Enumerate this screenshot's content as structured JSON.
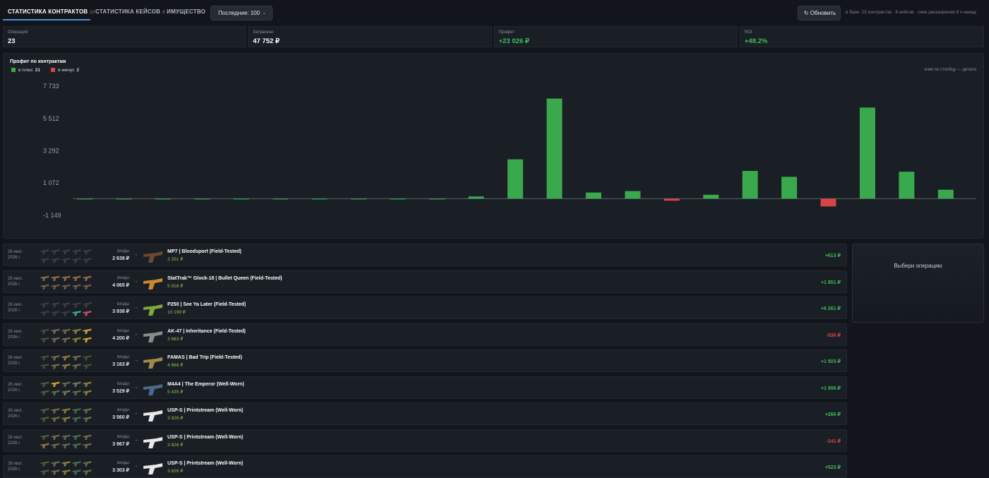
{
  "tabs": [
    {
      "label": "СТАТИСТИКА КОНТРАКТОВ",
      "count": "23",
      "active": true
    },
    {
      "label": "СТАТИСТИКА КЕЙСОВ",
      "count": "8",
      "active": false
    },
    {
      "label": "ИМУЩЕСТВО",
      "count": "",
      "active": false
    }
  ],
  "filter": {
    "value": "Последние: 100"
  },
  "refresh_label": "↻ Обновить",
  "db_info": "в базе: 23 контрактов · 8 кейсов · синк расширения 9 ч назад",
  "stats": [
    {
      "label": "Операций",
      "value": "23",
      "positive": false
    },
    {
      "label": "Затрачено",
      "value": "47 752 ₽",
      "positive": false
    },
    {
      "label": "Профит",
      "value": "+23 026 ₽",
      "positive": true
    },
    {
      "label": "ROI",
      "value": "+48.2%",
      "positive": true
    }
  ],
  "chart": {
    "title": "Профит по контрактам",
    "legend_pos_label": "в плюс",
    "legend_pos_count": "21",
    "legend_neg_label": "в минус",
    "legend_neg_count": "2",
    "hint": "клик по столбцу — детали"
  },
  "chart_data": {
    "type": "bar",
    "title": "Профит по контрактам",
    "ytick_labels": [
      "7 733",
      "5 512",
      "3 292",
      "1 072",
      "-1 149"
    ],
    "ylim": [
      -1149,
      7733
    ],
    "series": [
      {
        "name": "в плюс",
        "color": "#3aa84c"
      },
      {
        "name": "в минус",
        "color": "#d64545"
      }
    ],
    "values": [
      5,
      5,
      5,
      5,
      5,
      5,
      5,
      5,
      5,
      5,
      150,
      2700,
      6880,
      420,
      520,
      -141,
      266,
      1906,
      1503,
      -536,
      6261,
      1851,
      613
    ]
  },
  "side_panel": "Выбери операцию",
  "rows": [
    {
      "date1": "26 июл.",
      "date2": "2026 г.",
      "inputs_label": "входы",
      "inputs_total": "2 638 ₽",
      "arrow": "→",
      "out_name": "MP7 | Bloodsport (Field-Tested)",
      "out_price": "3 251 ₽",
      "profit": "+613 ₽",
      "positive": true,
      "out_color": "#6a4a2e",
      "in_colors": [
        "#3a3d42",
        "#3a3d42",
        "#3a3d42",
        "#3a3d42",
        "#3a3d42",
        "#3a3d42",
        "#3a3d42",
        "#3a3d42",
        "#3a3d42",
        "#3a3d42"
      ]
    },
    {
      "date1": "26 июл.",
      "date2": "2026 г.",
      "inputs_label": "входы",
      "inputs_total": "4 065 ₽",
      "arrow": "→",
      "out_name": "StatTrak™ Glock-18 | Bullet Queen (Field-Tested)",
      "out_price": "5 916 ₽",
      "profit": "+1 851 ₽",
      "positive": true,
      "out_color": "#c98a2a",
      "in_colors": [
        "#8a6a4a",
        "#8a6a4a",
        "#8a6a4a",
        "#8a6a4a",
        "#8a6a4a",
        "#6a5a4a",
        "#6a5a4a",
        "#6a5a4a",
        "#6a5a4a",
        "#6a5a4a"
      ]
    },
    {
      "date1": "26 июл.",
      "date2": "2026 г.",
      "inputs_label": "входы",
      "inputs_total": "3 938 ₽",
      "arrow": "→",
      "out_name": "P250 | See Ya Later (Field-Tested)",
      "out_price": "10 199 ₽",
      "profit": "+6 261 ₽",
      "positive": true,
      "out_color": "#7fa83a",
      "in_colors": [
        "#3a3d42",
        "#3a3d42",
        "#3a3d42",
        "#3a3d42",
        "#3a3d42",
        "#3a3d42",
        "#3a3d42",
        "#3a3d42",
        "#3aa89a",
        "#c94a6a"
      ]
    },
    {
      "date1": "26 июл.",
      "date2": "2026 г.",
      "inputs_label": "входы",
      "inputs_total": "4 200 ₽",
      "arrow": "→",
      "out_name": "AK-47 | Inheritance (Field-Tested)",
      "out_price": "3 663 ₽",
      "profit": "-536 ₽",
      "positive": false,
      "out_color": "#8a8a8a",
      "in_colors": [
        "#4a4a3a",
        "#6a6a4a",
        "#6a6a4a",
        "#8a7a3a",
        "#c9a02a",
        "#4a4a3a",
        "#6a6a4a",
        "#6a6a4a",
        "#8a7a3a",
        "#c9a02a"
      ]
    },
    {
      "date1": "26 июл.",
      "date2": "2026 г.",
      "inputs_label": "входы",
      "inputs_total": "3 163 ₽",
      "arrow": "→",
      "out_name": "FAMAS | Bad Trip (Field-Tested)",
      "out_price": "4 666 ₽",
      "profit": "+1 503 ₽",
      "positive": true,
      "out_color": "#a08a4a",
      "in_colors": [
        "#4a4a3a",
        "#6a6a4a",
        "#8a7a3a",
        "#6a6a4a",
        "#4a4a3a",
        "#4a4a3a",
        "#6a6a4a",
        "#8a7a3a",
        "#6a6a4a",
        "#4a4a3a"
      ]
    },
    {
      "date1": "26 июл.",
      "date2": "2026 г.",
      "inputs_label": "входы",
      "inputs_total": "3 529 ₽",
      "arrow": "→",
      "out_name": "M4A4 | The Emperor (Well-Worn)",
      "out_price": "5 435 ₽",
      "profit": "+1 906 ₽",
      "positive": true,
      "out_color": "#4a6a8a",
      "in_colors": [
        "#4a5a3a",
        "#c9a02a",
        "#5a6a4a",
        "#6a7a5a",
        "#8a7a3a",
        "#4a5a3a",
        "#5a6a4a",
        "#6a7a5a",
        "#5a6a4a",
        "#8a7a3a"
      ]
    },
    {
      "date1": "26 июл.",
      "date2": "2026 г.",
      "inputs_label": "входы",
      "inputs_total": "3 560 ₽",
      "arrow": "→",
      "out_name": "USP-S | Printstream (Well-Worn)",
      "out_price": "3 826 ₽",
      "profit": "+266 ₽",
      "positive": true,
      "out_color": "#e8e8e8",
      "in_colors": [
        "#4a5a3a",
        "#6a6a4a",
        "#8a7a3a",
        "#4a6a4a",
        "#6a6a4a",
        "#4a5a3a",
        "#6a6a4a",
        "#8a7a3a",
        "#4a6a4a",
        "#6a6a4a"
      ]
    },
    {
      "date1": "26 июл.",
      "date2": "2026 г.",
      "inputs_label": "входы",
      "inputs_total": "3 967 ₽",
      "arrow": "→",
      "out_name": "USP-S | Printstream (Well-Worn)",
      "out_price": "3 826 ₽",
      "profit": "-141 ₽",
      "positive": false,
      "out_color": "#e8e8e8",
      "in_colors": [
        "#4a5a3a",
        "#6a6a4a",
        "#5a6a4a",
        "#4a6a4a",
        "#6a6a4a",
        "#8a7a3a",
        "#6a6a4a",
        "#5a6a4a",
        "#4a6a4a",
        "#6a6a4a"
      ]
    },
    {
      "date1": "26 июл.",
      "date2": "2026 г.",
      "inputs_label": "входы",
      "inputs_total": "3 303 ₽",
      "arrow": "→",
      "out_name": "USP-S | Printstream (Well-Worn)",
      "out_price": "3 826 ₽",
      "profit": "+523 ₽",
      "positive": true,
      "out_color": "#e8e8e8",
      "in_colors": [
        "#4a5a3a",
        "#6a6a4a",
        "#8a7a3a",
        "#4a6a4a",
        "#6a6a4a",
        "#4a5a3a",
        "#6a6a4a",
        "#8a7a3a",
        "#4a6a4a",
        "#6a6a4a"
      ]
    }
  ]
}
